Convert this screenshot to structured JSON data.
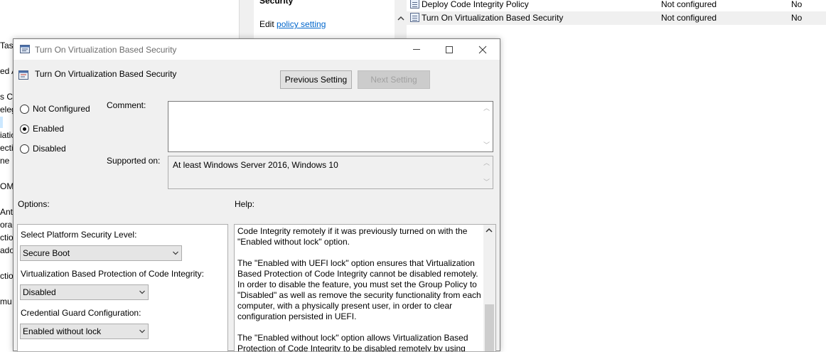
{
  "background": {
    "left_fragments": [
      "Task",
      "ed A",
      "s Cr",
      "eleg",
      "iatio",
      "ectio",
      "ne",
      "OM",
      " Ant",
      "orag",
      "ction",
      "adov",
      "ction",
      "mu"
    ],
    "description": {
      "title": "Security",
      "edit_prefix": "Edit",
      "edit_link": "policy setting"
    },
    "list_rows": [
      {
        "name": "Deploy Code Integrity Policy",
        "state": "Not configured",
        "comment": "No"
      },
      {
        "name": "Turn On Virtualization Based Security",
        "state": "Not configured",
        "comment": "No"
      }
    ]
  },
  "dialog": {
    "title": "Turn On Virtualization Based Security",
    "header_title": "Turn On Virtualization Based Security",
    "prev_button": "Previous Setting",
    "next_button": "Next Setting",
    "radios": {
      "not_configured": "Not Configured",
      "enabled": "Enabled",
      "disabled": "Disabled",
      "selected": "enabled"
    },
    "comment_label": "Comment:",
    "comment_value": "",
    "supported_label": "Supported on:",
    "supported_value": "At least Windows Server 2016, Windows 10",
    "options_label": "Options:",
    "help_label": "Help:",
    "options": {
      "platform_label": "Select Platform Security Level:",
      "platform_value": "Secure Boot",
      "vbs_label": "Virtualization Based Protection of Code Integrity:",
      "vbs_value": "Disabled",
      "cg_label": "Credential Guard Configuration:",
      "cg_value": "Enabled without lock"
    },
    "help_text": "Code Integrity remotely if it was previously turned on with the\n\"Enabled without lock\" option.\n\nThe \"Enabled with UEFI lock\" option ensures that Virtualization\nBased Protection of Code Integrity cannot be disabled remotely.\nIn order to disable the feature, you must set the Group Policy to\n\"Disabled\" as well as remove the security functionality from each\ncomputer, with a physically present user, in order to clear\nconfiguration persisted in UEFI.\n\nThe \"Enabled without lock\" option allows Virtualization Based\nProtection of Code Integrity to be disabled remotely by using"
  },
  "icons": {
    "window": "policy-window-icon",
    "header": "policy-setting-icon",
    "minimize": "minimize-icon",
    "maximize": "maximize-icon",
    "close": "close-icon",
    "dropdown": "chevron-down-icon",
    "scroll_up": "chevron-up-icon",
    "scroll_down": "chevron-down-icon"
  }
}
